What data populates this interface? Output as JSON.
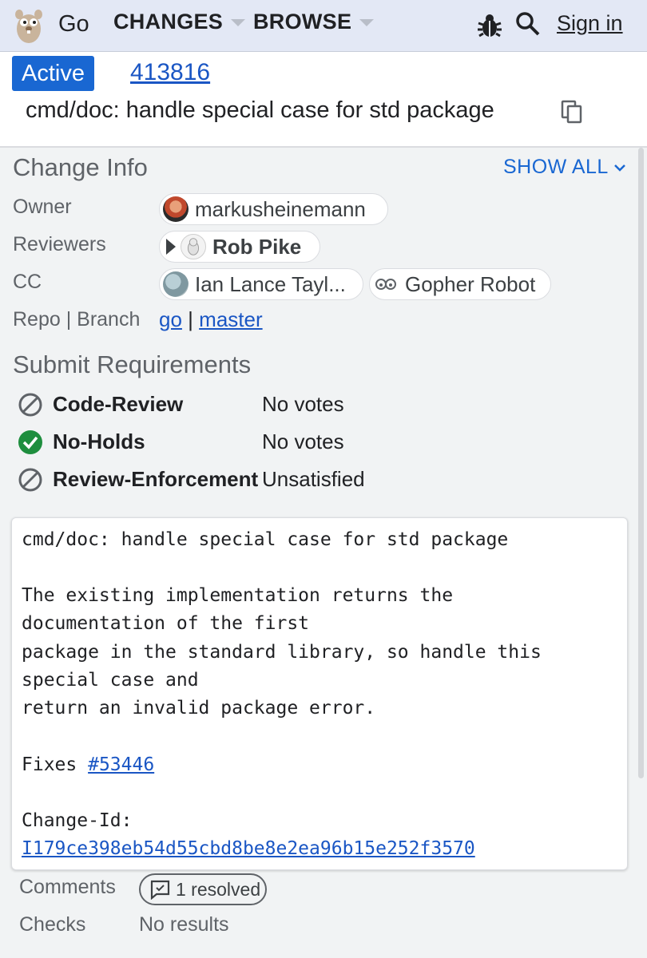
{
  "header": {
    "app_name": "Go",
    "nav": [
      {
        "label": "CHANGES"
      },
      {
        "label": "BROWSE"
      }
    ],
    "sign_in": "Sign in",
    "icons": [
      "gopher-logo-icon",
      "bug-icon",
      "search-icon"
    ]
  },
  "change": {
    "status": "Active",
    "number": "413816",
    "title": "cmd/doc: handle special case for std package"
  },
  "change_info": {
    "heading": "Change Info",
    "show_all": "SHOW ALL",
    "owner_label": "Owner",
    "owner": "markusheinemann",
    "reviewers_label": "Reviewers",
    "reviewer": "Rob Pike",
    "cc_label": "CC",
    "cc": [
      "Ian Lance Tayl...",
      "Gopher Robot"
    ],
    "repo_branch_label": "Repo | Branch",
    "repo": "go",
    "separator": "|",
    "branch": "master"
  },
  "submit_requirements": {
    "heading": "Submit Requirements",
    "items": [
      {
        "name": "Code-Review",
        "value": "No votes",
        "status": "blocked"
      },
      {
        "name": "No-Holds",
        "value": "No votes",
        "status": "satisfied"
      },
      {
        "name": "Review-Enforcement",
        "value": "Unsatisfied",
        "status": "blocked"
      }
    ]
  },
  "commit_message": {
    "line1": "cmd/doc: handle special case for std package",
    "line2": "The existing implementation returns the",
    "line3": "documentation of the first",
    "line4": "package in the standard library, so handle this",
    "line5": "special case and",
    "line6": "return an invalid package error.",
    "fixes_label": "Fixes ",
    "fixes_link": "#53446",
    "change_id_label": "Change-Id:",
    "change_id": "I179ce398eb54d55cbd8be8e2ea96b15e252f3570"
  },
  "footer": {
    "comments_label": "Comments",
    "comments_value": "1 resolved",
    "checks_label": "Checks",
    "checks_value": "No results"
  },
  "colors": {
    "accent": "#1967d2",
    "header_bg": "#e3e8f5",
    "page_bg": "#f1f3f4",
    "satisfied_green": "#1e8e3e"
  }
}
